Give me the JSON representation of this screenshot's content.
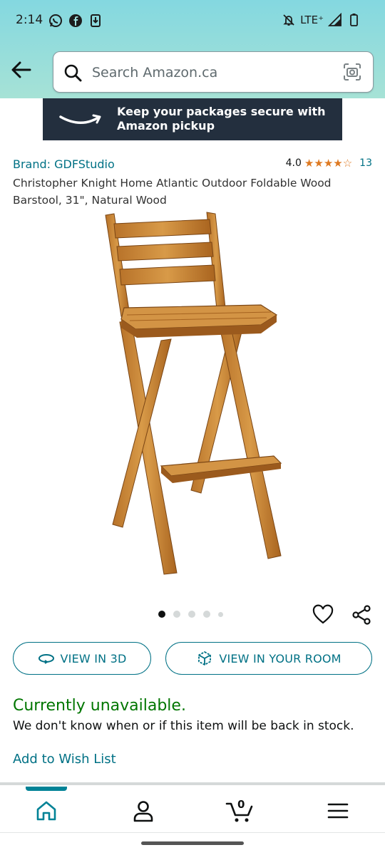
{
  "status_bar": {
    "time": "2:14",
    "network": "LTE⁺"
  },
  "search": {
    "placeholder": "Search Amazon.ca"
  },
  "banner": {
    "text": "Keep your packages secure with Amazon pickup"
  },
  "product": {
    "brand": "Brand: GDFStudio",
    "rating_value": "4.0",
    "rating_count": "13",
    "stars": 4,
    "title": "Christopher Knight Home Atlantic Outdoor Foldable Wood Barstool, 31\", Natural Wood"
  },
  "carousel": {
    "total_images": 5,
    "active_index": 0
  },
  "actions": {
    "view_3d": "VIEW IN 3D",
    "view_room": "VIEW IN YOUR ROOM"
  },
  "availability": {
    "status": "Currently unavailable.",
    "note": "We don't know when or if this item will be back in stock."
  },
  "wishlist": {
    "label": "Add to Wish List"
  },
  "bottom_nav": {
    "cart_count": "0",
    "items": [
      "home-icon",
      "account-icon",
      "cart-icon",
      "menu-icon"
    ]
  },
  "colors": {
    "link": "#007185",
    "available_green": "#007600",
    "star": "#de7921",
    "banner_bg": "#232f3e",
    "nav_accent": "#008296"
  }
}
